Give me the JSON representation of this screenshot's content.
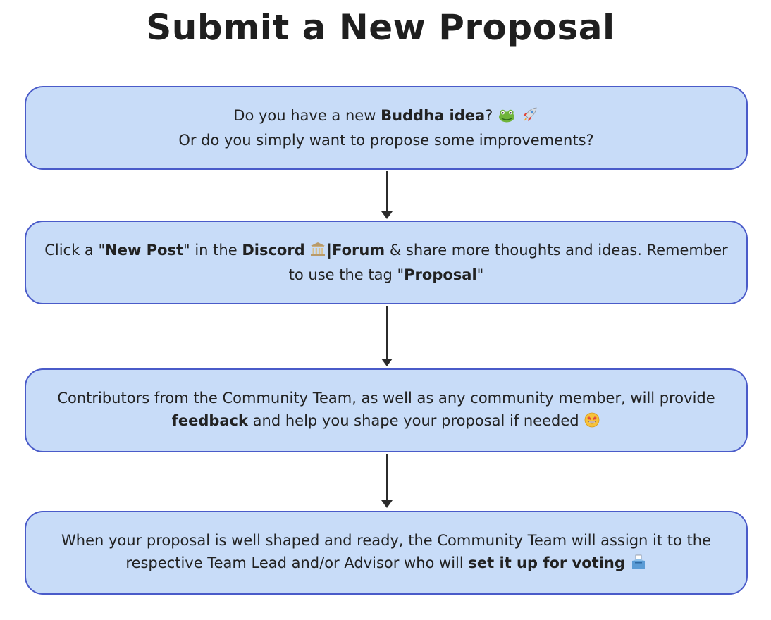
{
  "title": "Submit a New Proposal",
  "steps": [
    {
      "line1_before": "Do you have a new ",
      "line1_bold": "Buddha idea",
      "line1_after": "?",
      "line2": "Or do you simply want to propose some improvements?"
    },
    {
      "t1": "Click  a \"",
      "b1": "New Post",
      "t2": "\" in the ",
      "b2": "Discord",
      "b3": "|Forum",
      "t3": " & share more thoughts and ideas. Remember",
      "t4": "to use the tag \"",
      "b4": "Proposal",
      "t5": "\""
    },
    {
      "line1": "Contributors from the Community Team, as well as any community member, will provide",
      "b1": "feedback",
      "t2": " and help you shape your proposal if needed"
    },
    {
      "line1": "When your proposal is well shaped and ready, the Community Team will assign it to the",
      "t2": "respective Team Lead and/or Advisor who will ",
      "b1": "set it up for voting"
    }
  ],
  "icons": [
    "frog-icon",
    "rocket-icon",
    "classical-building-icon",
    "star-struck-face-icon",
    "ballot-box-icon"
  ],
  "colors": {
    "box_fill": "#c8dcf8",
    "box_border": "#4a5bc9",
    "arrow": "#2b2b2b",
    "text": "#1f1f1f"
  }
}
